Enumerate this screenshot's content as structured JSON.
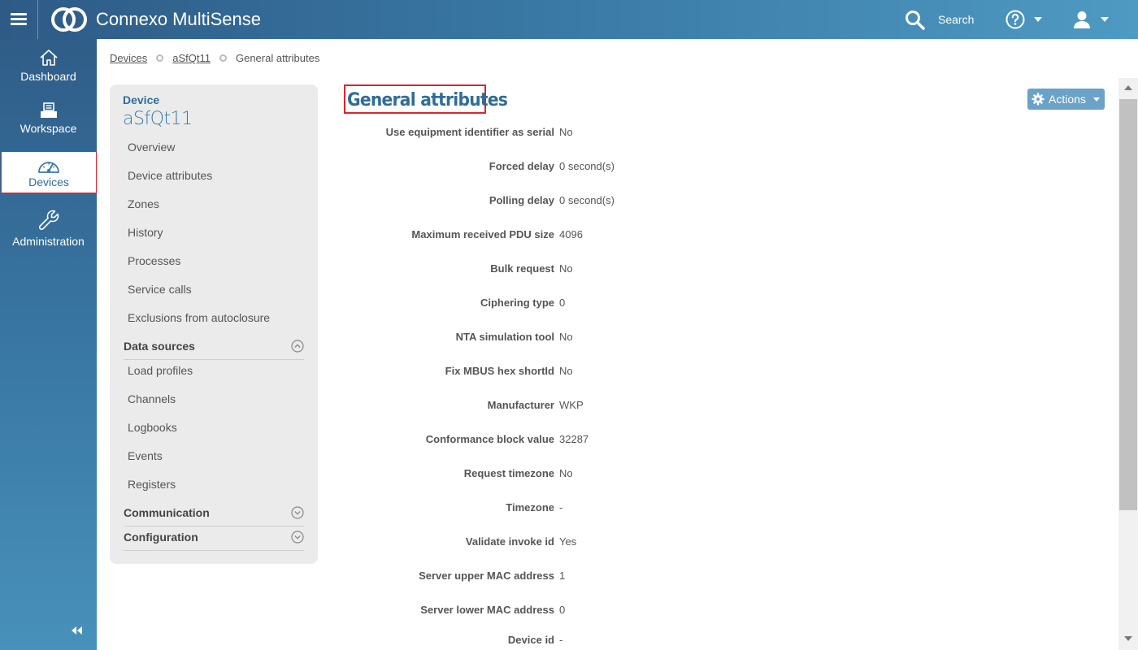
{
  "app": {
    "title": "Connexo MultiSense"
  },
  "header": {
    "search_label": "Search",
    "icons": [
      "menu-icon",
      "connexo-logo",
      "search-icon",
      "help-icon",
      "user-icon"
    ]
  },
  "leftnav": {
    "items": [
      {
        "label": "Dashboard",
        "icon": "home-icon"
      },
      {
        "label": "Workspace",
        "icon": "inbox-tray-icon"
      },
      {
        "label": "Devices",
        "icon": "gauge-icon",
        "active": true
      },
      {
        "label": "Administration",
        "icon": "wrench-icon"
      }
    ],
    "collapse_icon": "double-chevron-left-icon"
  },
  "breadcrumb": {
    "items": [
      "Devices",
      "aSfQt11",
      "General attributes"
    ]
  },
  "sidemenu": {
    "label": "Device",
    "device_name": "aSfQt11",
    "items": [
      "Overview",
      "Device attributes",
      "Zones",
      "History",
      "Processes",
      "Service calls",
      "Exclusions from autoclosure"
    ],
    "sections": [
      {
        "label": "Data sources",
        "expanded": true,
        "items": [
          "Load profiles",
          "Channels",
          "Logbooks",
          "Events",
          "Registers"
        ]
      },
      {
        "label": "Communication",
        "expanded": false
      },
      {
        "label": "Configuration",
        "expanded": false
      }
    ]
  },
  "main": {
    "title": "General attributes",
    "actions_label": "Actions",
    "attributes": [
      {
        "label": "Use equipment identifier as serial",
        "value": "No"
      },
      {
        "label": "Forced delay",
        "value": "0 second(s)"
      },
      {
        "label": "Polling delay",
        "value": "0 second(s)"
      },
      {
        "label": "Maximum received PDU size",
        "value": "4096"
      },
      {
        "label": "Bulk request",
        "value": "No"
      },
      {
        "label": "Ciphering type",
        "value": "0"
      },
      {
        "label": "NTA simulation tool",
        "value": "No"
      },
      {
        "label": "Fix MBUS hex shortId",
        "value": "No"
      },
      {
        "label": "Manufacturer",
        "value": "WKP"
      },
      {
        "label": "Conformance block value",
        "value": "32287"
      },
      {
        "label": "Request timezone",
        "value": "No"
      },
      {
        "label": "Timezone",
        "value": "-"
      },
      {
        "label": "Validate invoke id",
        "value": "Yes"
      },
      {
        "label": "Server upper MAC address",
        "value": "1"
      },
      {
        "label": "Server lower MAC address",
        "value": "0"
      },
      {
        "label": "Device id",
        "value": "-"
      }
    ]
  },
  "colors": {
    "brand_blue": "#2f6d98",
    "topbar_start": "#2e5a86",
    "topbar_end": "#4e9ac3",
    "actions_button": "#6aa2c8",
    "highlight_red": "#d9252e"
  }
}
